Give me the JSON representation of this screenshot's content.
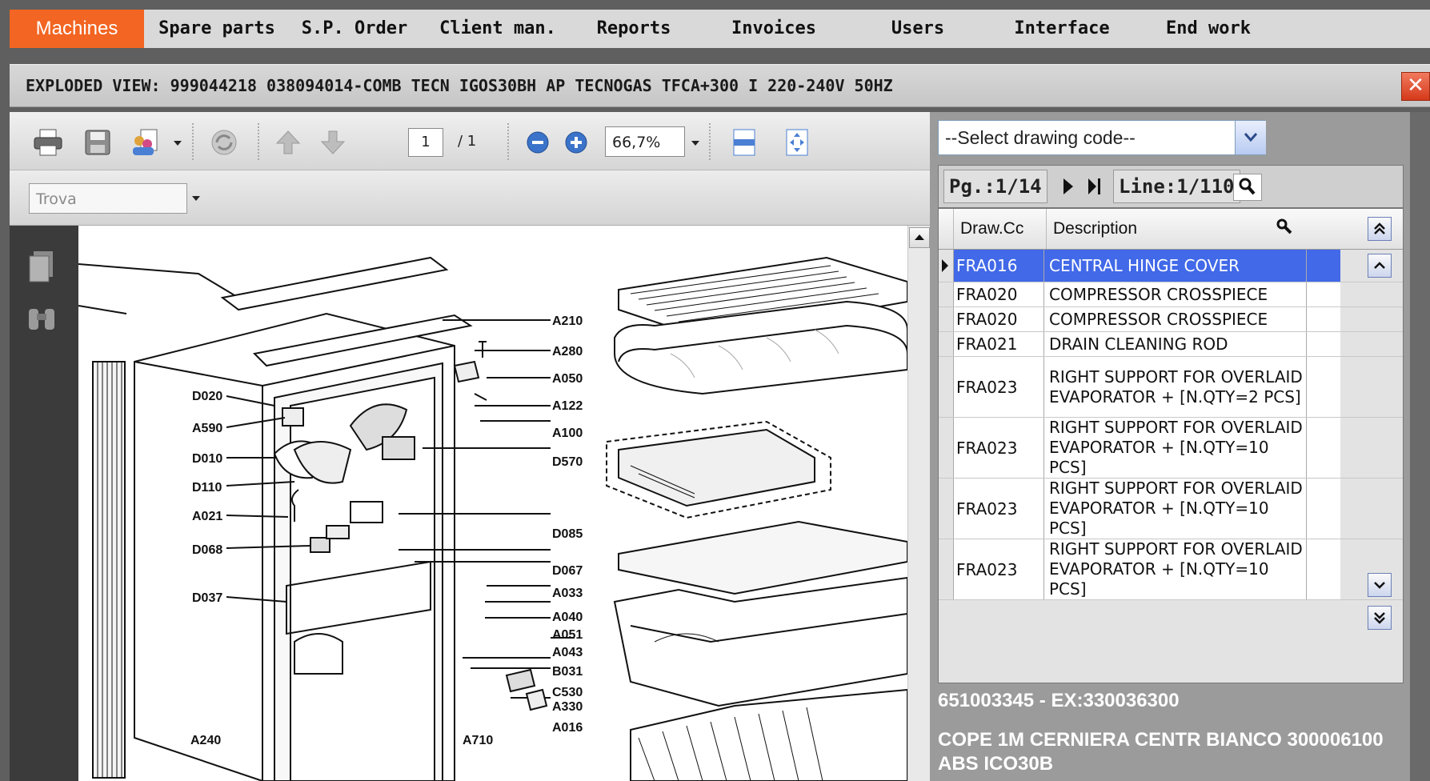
{
  "menu": {
    "items": [
      "Machines",
      "Spare parts",
      "S.P. Order",
      "Client man.",
      "Reports",
      "Invoices",
      "Users",
      "Interface",
      "End work"
    ],
    "active": "Machines"
  },
  "window": {
    "title": "EXPLODED VIEW: 999044218 038094014-COMB TECN IGOS30BH AP TECNOGAS TFCA+300 I 220-240V 50HZ",
    "close_label": "✕"
  },
  "viewer": {
    "page_current": "1",
    "page_total": "/ 1",
    "zoom": "66,7%",
    "find_placeholder": "Trova",
    "callouts": [
      "A210",
      "A280",
      "A050",
      "A122",
      "A100",
      "D570",
      "D085",
      "D067",
      "A033",
      "A040",
      "A051",
      "A043",
      "B031",
      "C530",
      "A330",
      "A016",
      "A710",
      "A240",
      "D020",
      "A590",
      "D010",
      "D110",
      "A021",
      "D068",
      "D037"
    ]
  },
  "panel": {
    "select_label": "--Select drawing code--",
    "pager": {
      "page": "Pg.:1/14",
      "line": "Line:1/110"
    },
    "columns": [
      "Draw.Cc",
      "Description"
    ],
    "rows": [
      {
        "code": "FRA016",
        "desc": "CENTRAL HINGE COVER",
        "selected": true
      },
      {
        "code": "FRA020",
        "desc": "COMPRESSOR CROSSPIECE"
      },
      {
        "code": "FRA020",
        "desc": "COMPRESSOR CROSSPIECE"
      },
      {
        "code": "FRA021",
        "desc": "DRAIN CLEANING ROD"
      },
      {
        "code": "FRA023",
        "desc": "RIGHT SUPPORT FOR OVERLAID EVAPORATOR + [N.QTY=2 PCS]"
      },
      {
        "code": "FRA023",
        "desc": "RIGHT SUPPORT FOR OVERLAID EVAPORATOR + [N.QTY=10 PCS]"
      },
      {
        "code": "FRA023",
        "desc": "RIGHT SUPPORT FOR OVERLAID EVAPORATOR + [N.QTY=10 PCS]"
      },
      {
        "code": "FRA023",
        "desc": "RIGHT SUPPORT FOR OVERLAID EVAPORATOR + [N.QTY=10 PCS]"
      }
    ],
    "detail_code": "651003345 - EX:330036300",
    "detail_desc": "COPE 1M CERNIERA CENTR BIANCO 300006100 ABS ICO30B"
  },
  "colors": {
    "accent": "#f26522",
    "selection": "#4169e8",
    "panel": "#9b9b9b"
  }
}
